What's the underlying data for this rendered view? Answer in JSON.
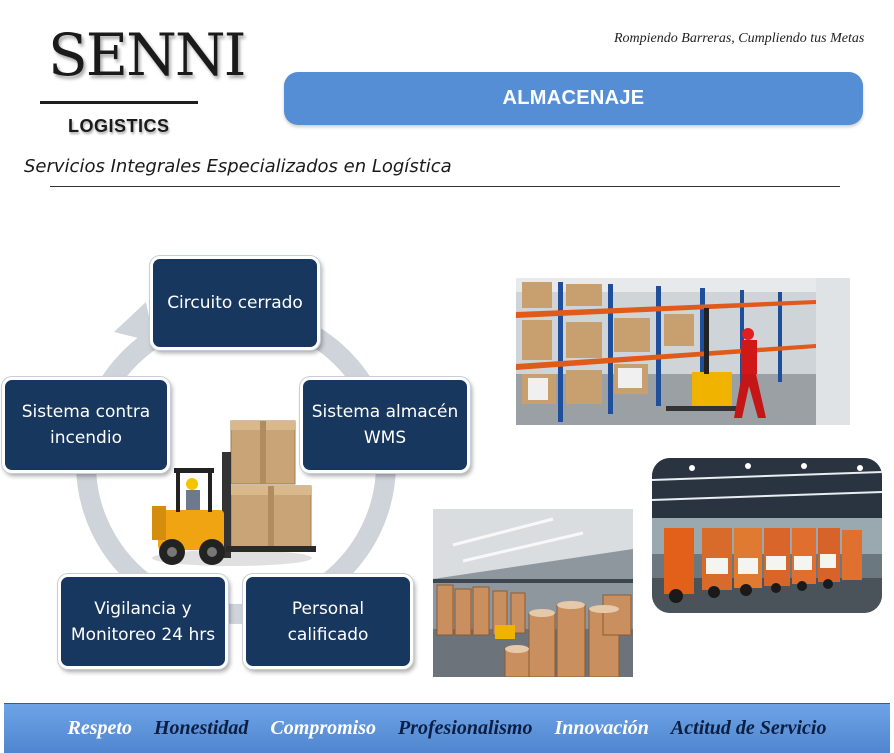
{
  "logo": {
    "name": "SENNI",
    "sub": "LOGISTICS"
  },
  "tagline": "Rompiendo Barreras, Cumpliendo tus Metas",
  "title": "ALMACENAJE",
  "subtitle": "Servicios Integrales Especializados en Logística",
  "cycle_items": [
    {
      "label": "Circuito cerrado"
    },
    {
      "label": "Sistema almacén\nWMS"
    },
    {
      "label": "Personal\ncalificado"
    },
    {
      "label": "Vigilancia y\nMonitoreo 24 hrs"
    },
    {
      "label": "Sistema contra\nincendio"
    }
  ],
  "footer_values": [
    {
      "label": "Respeto",
      "style": "light"
    },
    {
      "label": "Honestidad",
      "style": "dark"
    },
    {
      "label": "Compromiso",
      "style": "light"
    },
    {
      "label": "Profesionalismo",
      "style": "dark"
    },
    {
      "label": "Innovación",
      "style": "light"
    },
    {
      "label": "Actitud de Servicio",
      "style": "dark"
    }
  ],
  "colors": {
    "title_bar": "#558ed5",
    "box_fill": "#17375e",
    "footer": "#5b93da"
  }
}
